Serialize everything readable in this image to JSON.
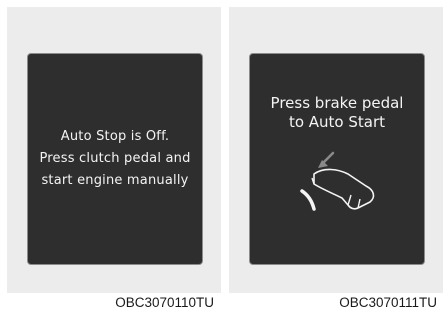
{
  "left_panel": {
    "message_lines": [
      "Auto Stop is Off.",
      "Press clutch pedal and",
      "start engine manually"
    ],
    "caption": "OBC3070110TU"
  },
  "right_panel": {
    "message_lines": [
      "Press brake pedal",
      "to Auto Start"
    ],
    "icon": "foot-on-brake-pedal-icon",
    "caption": "OBC3070111TU"
  },
  "colors": {
    "panel_bg": "#ececec",
    "screen_bg": "#2e2e2e",
    "screen_text": "#f4f4f4",
    "arrow": "#8a8a8a"
  }
}
